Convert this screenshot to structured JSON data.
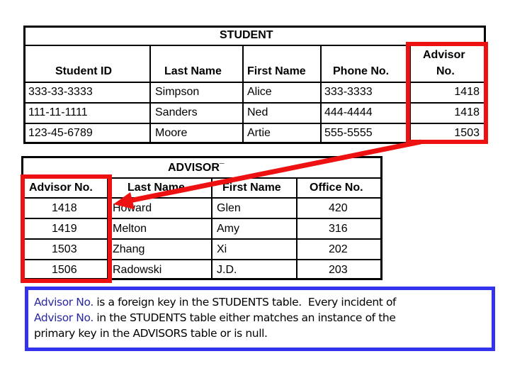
{
  "student_table": {
    "title": "STUDENT",
    "headers": [
      "Student ID",
      "Last Name",
      "First Name",
      "Phone No.",
      "Advisor",
      "No."
    ],
    "rows": [
      [
        "333-33-3333",
        "Simpson",
        "Alice",
        "333-3333",
        "1418"
      ],
      [
        "111-11-1111",
        "Sanders",
        "Ned",
        "444-4444",
        "1418"
      ],
      [
        "123-45-6789",
        "Moore",
        "Artie",
        "555-5555",
        "1503"
      ]
    ]
  },
  "advisor_table": {
    "title": "ADVISOR",
    "title_mark": "¯",
    "headers": [
      "Advisor No.",
      "Last Name",
      "First Name",
      "Office No."
    ],
    "rows": [
      [
        "1418",
        "Howard",
        "Glen",
        "420"
      ],
      [
        "1419",
        "Melton",
        "Amy",
        "316"
      ],
      [
        "1503",
        "Zhang",
        "Xi",
        "202"
      ],
      [
        "1506",
        "Radowski",
        "J.D.",
        "203"
      ]
    ]
  },
  "note": {
    "line1_highlight": "Advisor No.",
    "line1_rest": " is a foreign key in the STUDENTS table.  Every incident of",
    "line2_highlight": "Advisor No.",
    "line2_rest": " in the STUDENTS table either matches an instance of the",
    "line3": "primary key in the ADVISORS table or is null."
  },
  "colors": {
    "highlight_red": "#ee1111",
    "note_border_blue": "#3333ee",
    "note_highlight_text": "#2a2aa0"
  }
}
